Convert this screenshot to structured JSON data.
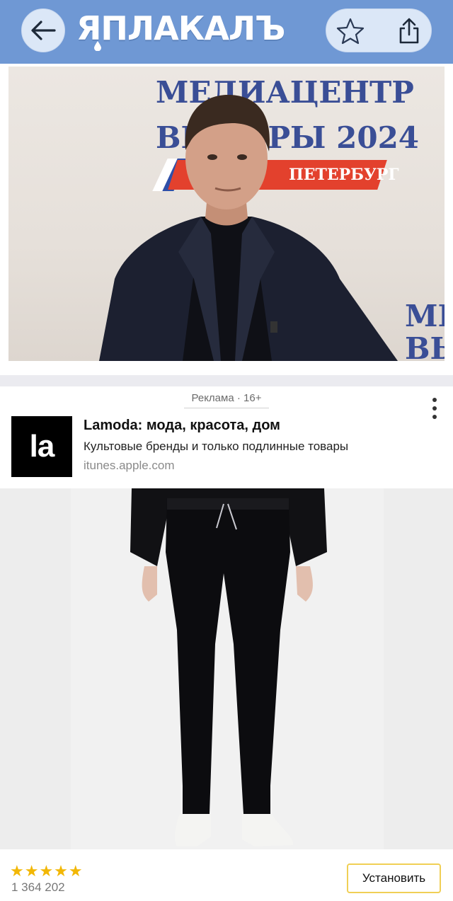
{
  "header": {
    "logo_text": "ЯПЛАКАЛЪ",
    "back_icon": "arrow-left-icon",
    "favorite_icon": "star-outline-icon",
    "share_icon": "share-icon",
    "bar_color": "#6f98d4"
  },
  "photo": {
    "backdrop_line1": "МЕДИАЦЕНТР",
    "backdrop_line2": "ВЫБОРЫ 2024",
    "backdrop_strip": "ПЕТЕРБУРГ",
    "backdrop_corner1": "МЕ",
    "backdrop_corner2": "ВЫ"
  },
  "ad": {
    "label": "Реклама · 16+",
    "logo_text": "la",
    "title": "Lamoda: мода, красота, дом",
    "description": "Культовые бренды и только подлинные товары",
    "domain": "itunes.apple.com",
    "menu_icon": "more-vertical-icon",
    "rating_stars": "★★★★★",
    "rating_count": "1 364 202",
    "install_label": "Установить",
    "star_color": "#f2b705",
    "button_border": "#f0cf55"
  }
}
